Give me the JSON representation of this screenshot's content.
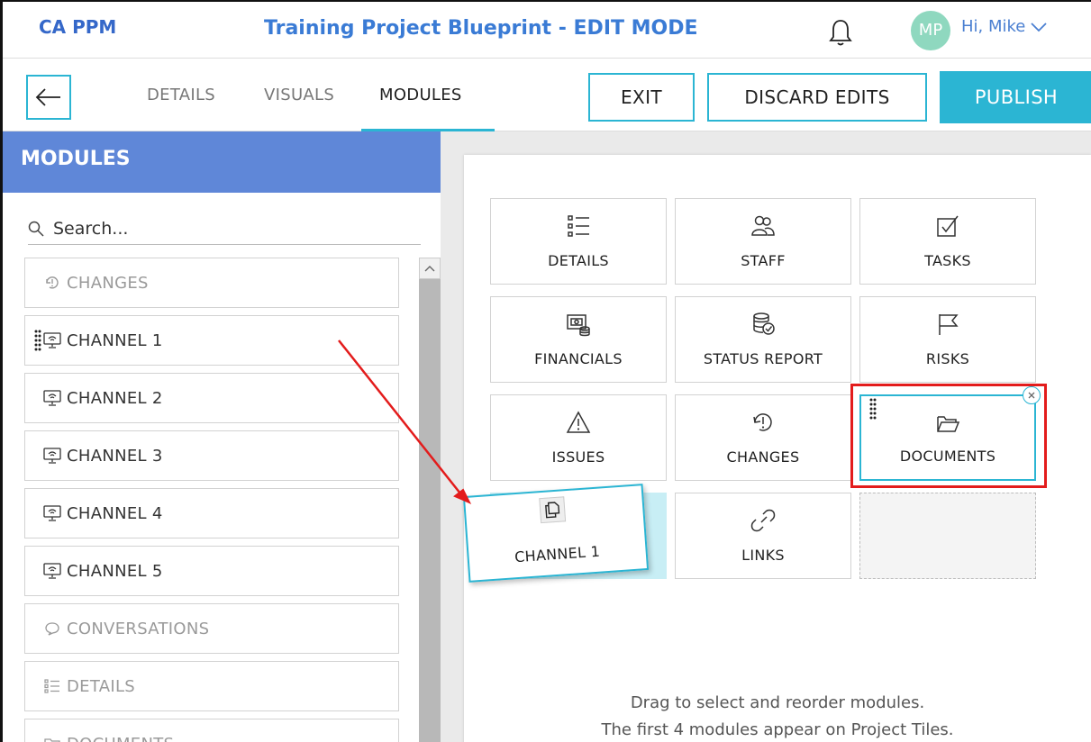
{
  "header": {
    "brand": "CA PPM",
    "title": "Training Project Blueprint - EDIT MODE",
    "avatar_initials": "MP",
    "greeting": "Hi, Mike"
  },
  "nav": {
    "tabs": [
      "DETAILS",
      "VISUALS",
      "MODULES"
    ],
    "active_tab": "MODULES",
    "exit_label": "EXIT",
    "discard_label": "DISCARD EDITS",
    "publish_label": "PUBLISH"
  },
  "sidebar": {
    "heading": "MODULES",
    "search_placeholder": "Search...",
    "items": [
      {
        "label": "CHANGES",
        "icon": "changes-icon",
        "enabled": false
      },
      {
        "label": "CHANNEL 1",
        "icon": "channel-icon",
        "enabled": true
      },
      {
        "label": "CHANNEL 2",
        "icon": "channel-icon",
        "enabled": true
      },
      {
        "label": "CHANNEL 3",
        "icon": "channel-icon",
        "enabled": true
      },
      {
        "label": "CHANNEL 4",
        "icon": "channel-icon",
        "enabled": true
      },
      {
        "label": "CHANNEL 5",
        "icon": "channel-icon",
        "enabled": true
      },
      {
        "label": "CONVERSATIONS",
        "icon": "conversation-icon",
        "enabled": false
      },
      {
        "label": "DETAILS",
        "icon": "details-icon",
        "enabled": false
      },
      {
        "label": "DOCUMENTS",
        "icon": "documents-icon",
        "enabled": false
      }
    ]
  },
  "grid": {
    "tiles": [
      {
        "label": "DETAILS",
        "icon": "details-icon"
      },
      {
        "label": "STAFF",
        "icon": "staff-icon"
      },
      {
        "label": "TASKS",
        "icon": "tasks-icon"
      },
      {
        "label": "FINANCIALS",
        "icon": "financials-icon"
      },
      {
        "label": "STATUS REPORT",
        "icon": "status-report-icon"
      },
      {
        "label": "RISKS",
        "icon": "risks-icon"
      },
      {
        "label": "ISSUES",
        "icon": "issues-icon"
      },
      {
        "label": "CHANGES",
        "icon": "changes-icon"
      },
      {
        "label": "DOCUMENTS",
        "icon": "documents-icon"
      },
      {
        "label": "",
        "icon": ""
      },
      {
        "label": "LINKS",
        "icon": "links-icon"
      },
      {
        "label": "",
        "icon": ""
      }
    ],
    "dragging_tile": {
      "label": "CHANNEL 1",
      "icon": "copy-icon"
    }
  },
  "hint": {
    "line1": "Drag to select and reorder modules.",
    "line2": "The first 4 modules appear on Project Tiles."
  },
  "colors": {
    "accent": "#2bb5d3",
    "brand": "#3568c9",
    "sidebar_header": "#5f87d8",
    "annotation": "#e31c1c"
  }
}
